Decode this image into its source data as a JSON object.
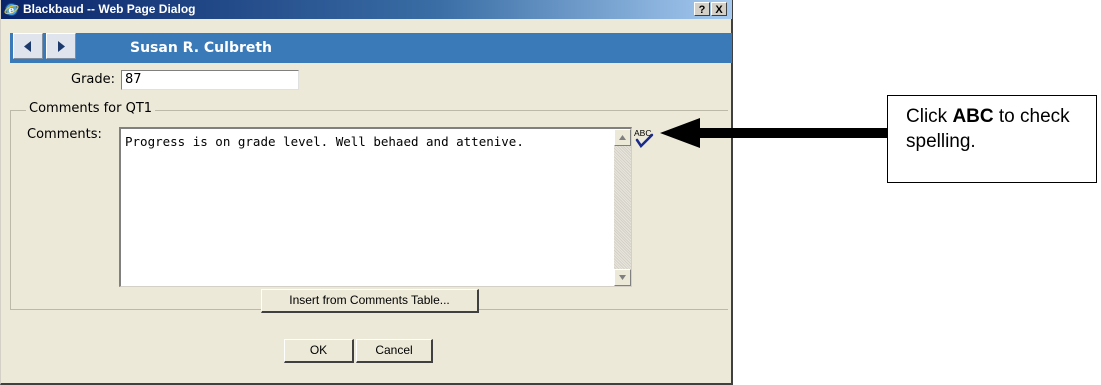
{
  "window": {
    "title": "Blackbaud -- Web Page Dialog",
    "help_label": "?",
    "close_label": "X"
  },
  "nav": {
    "student_name": "Susan R. Culbreth",
    "prev_icon": "triangle-left-icon",
    "next_icon": "triangle-right-icon"
  },
  "form": {
    "grade_label": "Grade:",
    "grade_value": "87",
    "section_label": "Comments for QT1",
    "comments_label": "Comments:",
    "comments_value": "Progress is on grade level. Well behaed and attenive.",
    "spellcheck_icon": "abc-checkmark-icon",
    "spellcheck_text": "ABC",
    "insert_button": "Insert from Comments Table...",
    "ok_button": "OK",
    "cancel_button": "Cancel"
  },
  "annotation": {
    "prefix": "Click ",
    "emphasis": "ABC",
    "suffix": " to check spelling."
  },
  "colors": {
    "title_gradient_start": "#0a246a",
    "nav_bar": "#3a7ab8",
    "dialog_bg": "#ece9d8"
  }
}
